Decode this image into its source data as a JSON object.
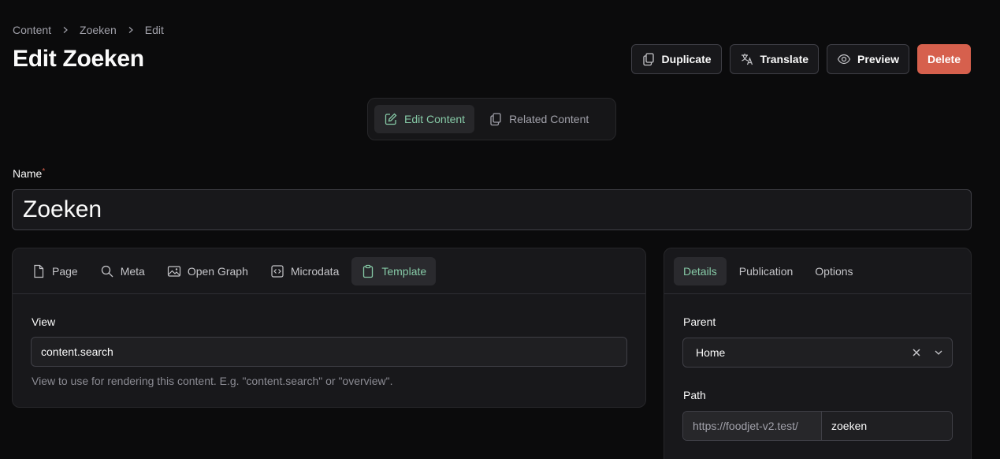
{
  "breadcrumb": [
    "Content",
    "Zoeken",
    "Edit"
  ],
  "page_title": "Edit Zoeken",
  "actions": {
    "duplicate": "Duplicate",
    "translate": "Translate",
    "preview": "Preview",
    "delete": "Delete"
  },
  "view_switch": {
    "edit_content": "Edit Content",
    "related_content": "Related Content"
  },
  "name_field": {
    "label": "Name",
    "required_marker": "*",
    "value": "Zoeken"
  },
  "left_tabs": [
    "Page",
    "Meta",
    "Open Graph",
    "Microdata",
    "Template"
  ],
  "left_active_tab": "Template",
  "template": {
    "view_label": "View",
    "view_value": "content.search",
    "view_help": "View to use for rendering this content. E.g. \"content.search\" or \"overview\"."
  },
  "right_tabs": [
    "Details",
    "Publication",
    "Options"
  ],
  "right_active_tab": "Details",
  "details": {
    "parent_label": "Parent",
    "parent_value": "Home",
    "path_label": "Path",
    "path_prefix": "https://foodjet-v2.test/",
    "path_value": "zoeken"
  },
  "colors": {
    "background": "#0b0b0c",
    "panel": "#18181b",
    "accent": "#86c9a6",
    "danger": "#d6604d"
  }
}
